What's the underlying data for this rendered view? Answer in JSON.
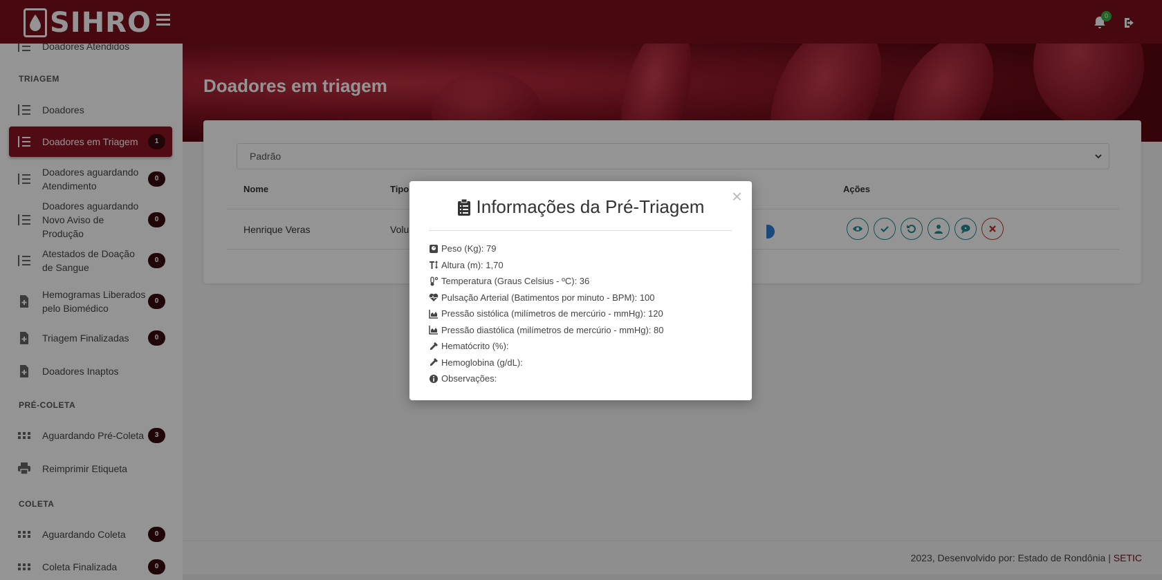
{
  "app": {
    "name": "SIHRO",
    "notification_count": "0"
  },
  "sidebar": {
    "top_partial": "Doadores Atendidos",
    "sections": {
      "triagem": "TRIAGEM",
      "pre_coleta": "PRÉ-COLETA",
      "coleta": "COLETA"
    },
    "items": [
      {
        "label": "Doadores",
        "badge": ""
      },
      {
        "label": "Doadores em Triagem",
        "badge": "1"
      },
      {
        "label": "Doadores aguardando Atendimento",
        "badge": "0"
      },
      {
        "label": "Doadores aguardando Novo Aviso de Produção",
        "badge": "0"
      },
      {
        "label": "Atestados de Doação de Sangue",
        "badge": "0"
      },
      {
        "label": "Hemogramas Liberados pelo Biomédico",
        "badge": "0"
      },
      {
        "label": "Triagem Finalizadas",
        "badge": "0"
      },
      {
        "label": "Doadores Inaptos",
        "badge": ""
      },
      {
        "label": "Aguardando Pré-Coleta",
        "badge": "3"
      },
      {
        "label": "Reimprimir Etiqueta",
        "badge": ""
      },
      {
        "label": "Aguardando Coleta",
        "badge": "0"
      },
      {
        "label": "Coleta Finalizada",
        "badge": "0"
      }
    ]
  },
  "main": {
    "title": "Doadores em triagem",
    "filter_value": "Padrão",
    "table": {
      "headers": {
        "nome": "Nome",
        "tipo": "Tipo",
        "acoes": "Ações"
      },
      "rows": [
        {
          "nome": "Henrique Veras",
          "tipo": "Volur"
        }
      ]
    }
  },
  "modal": {
    "title": "Informações da Pré-Triagem",
    "close": "×",
    "fields": [
      {
        "icon": "weight-icon",
        "text": "Peso (Kg): 79"
      },
      {
        "icon": "text-height-icon",
        "text": "Altura (m): 1,70"
      },
      {
        "icon": "thermometer-icon",
        "text": "Temperatura (Graus Celsius - ºC): 36"
      },
      {
        "icon": "heartbeat-icon",
        "text": "Pulsação Arterial (Batimentos por minuto - BPM): 100"
      },
      {
        "icon": "chart-area-icon",
        "text": "Pressão sistólica (milímetros de mercúrio - mmHg): 120"
      },
      {
        "icon": "chart-area-icon",
        "text": "Pressão diastólica (milímetros de mercúrio - mmHg): 80"
      },
      {
        "icon": "eyedropper-icon",
        "text": "Hematócrito (%):"
      },
      {
        "icon": "eyedropper-icon",
        "text": "Hemoglobina (g/dL):"
      },
      {
        "icon": "info-circle-icon",
        "text": "Observações:"
      }
    ]
  },
  "footer": {
    "text": "2023, Desenvolvido por: Estado de Rondônia | ",
    "link": "SETIC"
  },
  "colors": {
    "brand": "#7a0f1c",
    "active_item": "#8b1424",
    "badge": "#3a0b10",
    "action_teal": "#1e8a92",
    "danger": "#c0392b"
  }
}
